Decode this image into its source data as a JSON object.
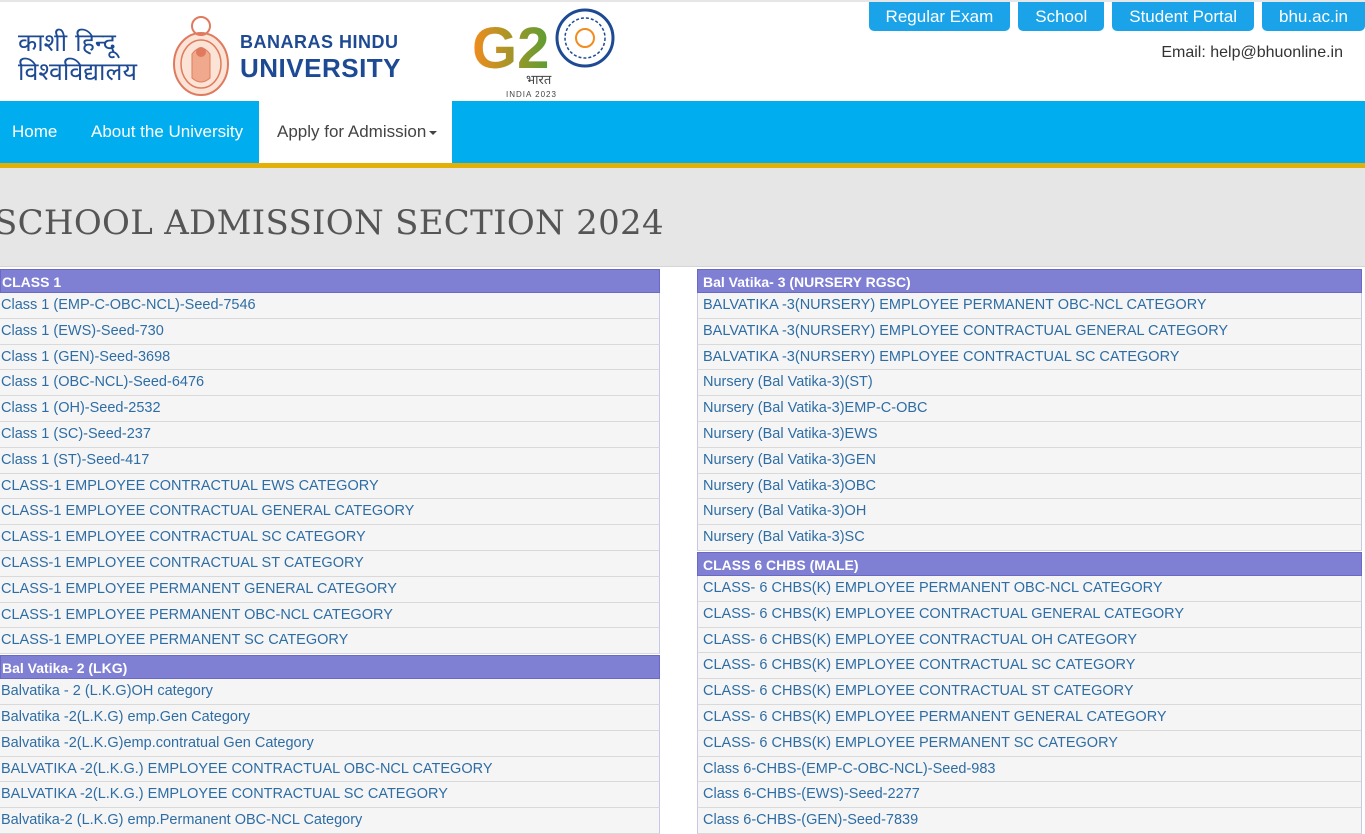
{
  "header": {
    "hindi_line1": "काशी हिन्दू",
    "hindi_line2": "विश्वविद्यालय",
    "univ_line1": "BANARAS HINDU",
    "univ_line2": "UNIVERSITY",
    "g20_text": "G20",
    "g20_bharat": "भारत",
    "g20_sub": "INDIA 2023",
    "email": "Email: help@bhuonline.in"
  },
  "toplinks": [
    "Regular Exam",
    "School",
    "Student Portal",
    "bhu.ac.in"
  ],
  "nav": {
    "home": "Home",
    "about": "About the University",
    "apply": "Apply for Admission"
  },
  "page_title": "SCHOOL ADMISSION SECTION 2024",
  "left_sections": [
    {
      "title": "CLASS 1",
      "items": [
        "Class 1 (EMP-C-OBC-NCL)-Seed-7546",
        "Class 1 (EWS)-Seed-730",
        "Class 1 (GEN)-Seed-3698",
        "Class 1 (OBC-NCL)-Seed-6476",
        "Class 1 (OH)-Seed-2532",
        "Class 1 (SC)-Seed-237",
        "Class 1 (ST)-Seed-417",
        "CLASS-1 EMPLOYEE CONTRACTUAL EWS CATEGORY",
        "CLASS-1 EMPLOYEE CONTRACTUAL GENERAL CATEGORY",
        "CLASS-1 EMPLOYEE CONTRACTUAL SC CATEGORY",
        "CLASS-1 EMPLOYEE CONTRACTUAL ST CATEGORY",
        "CLASS-1 EMPLOYEE PERMANENT GENERAL CATEGORY",
        "CLASS-1 EMPLOYEE PERMANENT OBC-NCL CATEGORY",
        "CLASS-1 EMPLOYEE PERMANENT SC CATEGORY"
      ]
    },
    {
      "title": "Bal Vatika- 2 (LKG)",
      "items": [
        "Balvatika - 2 (L.K.G)OH category",
        "Balvatika -2(L.K.G) emp.Gen Category",
        "Balvatika -2(L.K.G)emp.contratual Gen Category",
        "BALVATIKA -2(L.K.G.) EMPLOYEE CONTRACTUAL OBC-NCL CATEGORY",
        "BALVATIKA -2(L.K.G.) EMPLOYEE CONTRACTUAL SC CATEGORY",
        "Balvatika-2 (L.K.G) emp.Permanent OBC-NCL Category"
      ]
    }
  ],
  "right_sections": [
    {
      "title": "Bal Vatika- 3 (NURSERY RGSC)",
      "items": [
        "BALVATIKA -3(NURSERY) EMPLOYEE PERMANENT OBC-NCL CATEGORY",
        "BALVATIKA -3(NURSERY) EMPLOYEE CONTRACTUAL GENERAL CATEGORY",
        "BALVATIKA -3(NURSERY) EMPLOYEE CONTRACTUAL SC CATEGORY",
        "Nursery (Bal Vatika-3)(ST)",
        "Nursery (Bal Vatika-3)EMP-C-OBC",
        "Nursery (Bal Vatika-3)EWS",
        "Nursery (Bal Vatika-3)GEN",
        "Nursery (Bal Vatika-3)OBC",
        "Nursery (Bal Vatika-3)OH",
        "Nursery (Bal Vatika-3)SC"
      ]
    },
    {
      "title": "CLASS 6 CHBS (MALE)",
      "items": [
        "CLASS- 6 CHBS(K) EMPLOYEE PERMANENT OBC-NCL CATEGORY",
        "CLASS- 6 CHBS(K) EMPLOYEE CONTRACTUAL GENERAL CATEGORY",
        "CLASS- 6 CHBS(K) EMPLOYEE CONTRACTUAL OH CATEGORY",
        "CLASS- 6 CHBS(K) EMPLOYEE CONTRACTUAL SC CATEGORY",
        "CLASS- 6 CHBS(K) EMPLOYEE CONTRACTUAL ST CATEGORY",
        "CLASS- 6 CHBS(K) EMPLOYEE PERMANENT GENERAL CATEGORY",
        "CLASS- 6 CHBS(K) EMPLOYEE PERMANENT SC CATEGORY",
        "Class 6-CHBS-(EMP-C-OBC-NCL)-Seed-983",
        "Class 6-CHBS-(EWS)-Seed-2277",
        "Class 6-CHBS-(GEN)-Seed-7839"
      ]
    }
  ]
}
